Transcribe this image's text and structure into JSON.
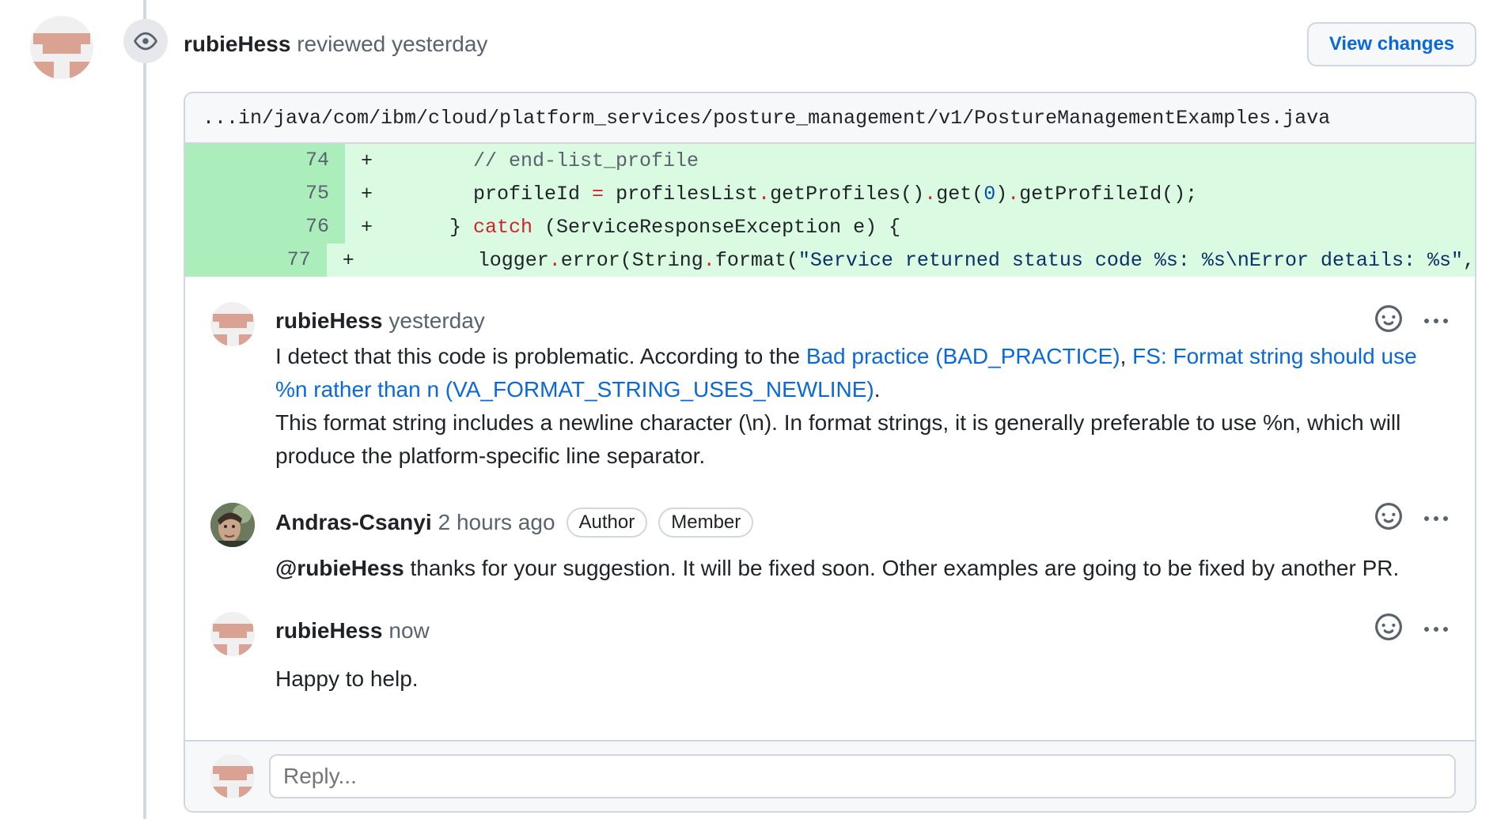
{
  "review": {
    "author": "rubieHess",
    "action": "reviewed",
    "time": "yesterday",
    "view_changes_label": "View changes"
  },
  "file": {
    "path": "...in/java/com/ibm/cloud/platform_services/posture_management/v1/PostureManagementExamples.java"
  },
  "diff": {
    "sign": "+",
    "lines": [
      {
        "number": "74",
        "indent": "      ",
        "comment": "// end-list_profile"
      },
      {
        "number": "75",
        "indent": "      ",
        "p1": "profileId ",
        "op1": "=",
        "p2": " profilesList",
        "op2": ".",
        "p3": "getProfiles()",
        "op3": ".",
        "p4": "get(",
        "num": "0",
        "p5": ")",
        "op4": ".",
        "p6": "getProfileId();"
      },
      {
        "number": "76",
        "indent": "    ",
        "p1": "} ",
        "kw": "catch",
        "p2": " (ServiceResponseException e) {"
      },
      {
        "number": "77",
        "indent": "        ",
        "p1": "logger",
        "op1": ".",
        "p2": "error(String",
        "op2": ".",
        "p3": "format(",
        "str": "\"Service returned status code %s: %s\\nError details: %s\"",
        "p4": ","
      }
    ]
  },
  "comments": [
    {
      "author": "rubieHess",
      "time": "yesterday",
      "body_pre": "I detect that this code is problematic. According to the ",
      "link1": "Bad practice (BAD_PRACTICE)",
      "sep": ", ",
      "link2": "FS: Format string should use %n rather than n (VA_FORMAT_STRING_USES_NEWLINE)",
      "body_post": ".",
      "body_line2": "This format string includes a newline character (\\n). In format strings, it is generally preferable to use %n, which will produce the platform-specific line separator."
    },
    {
      "author": "Andras-Csanyi",
      "time": "2 hours ago",
      "badges": [
        "Author",
        "Member"
      ],
      "mention": "@rubieHess",
      "body": " thanks for your suggestion. It will be fixed soon. Other examples are going to be fixed by another PR."
    },
    {
      "author": "rubieHess",
      "time": "now",
      "body": "Happy to help."
    }
  ],
  "reply": {
    "placeholder": "Reply..."
  }
}
